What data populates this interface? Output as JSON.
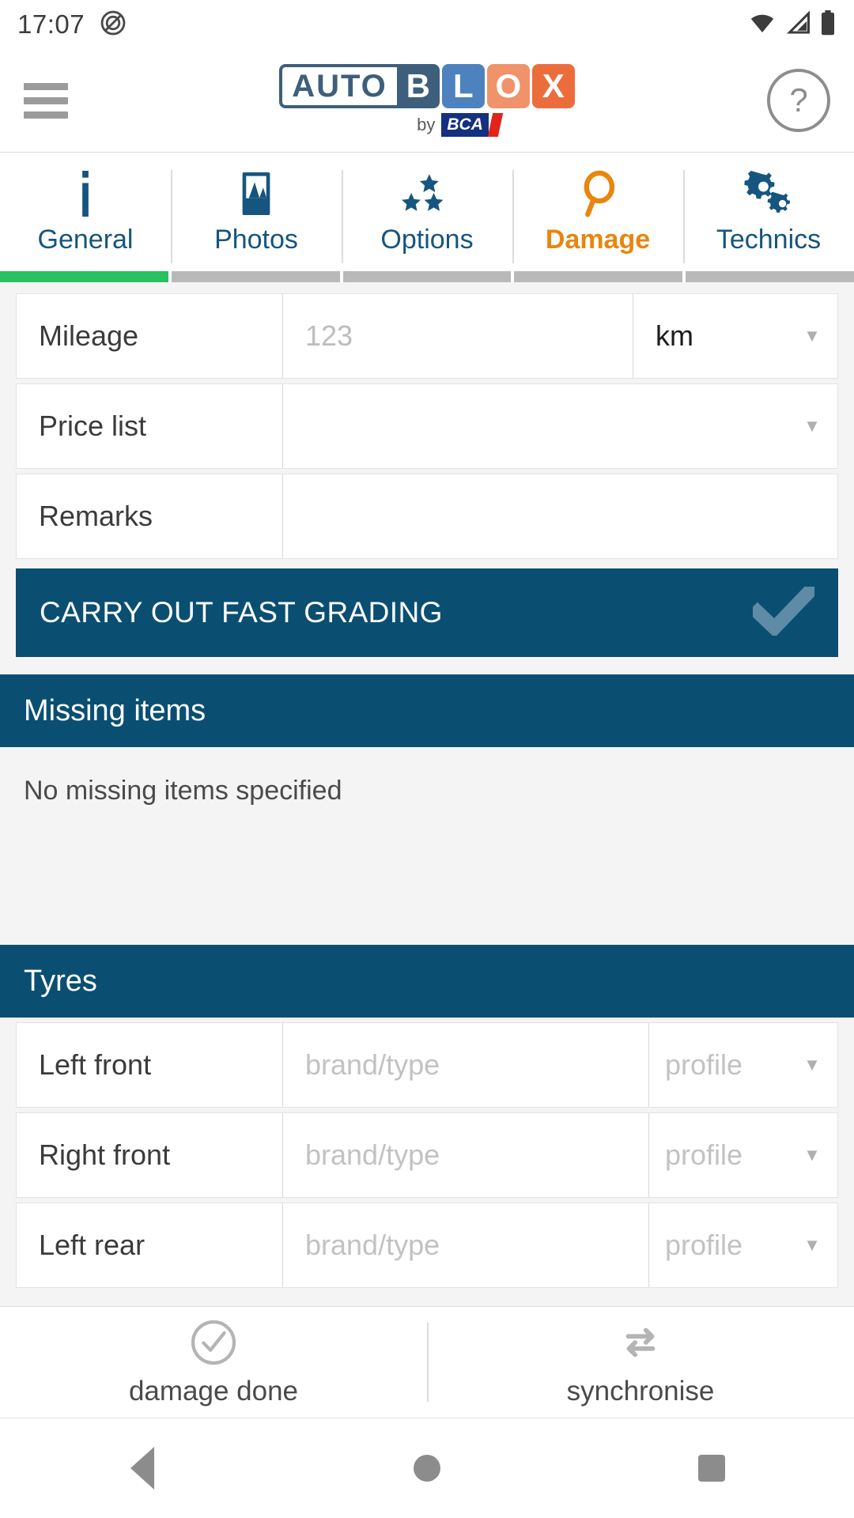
{
  "status_bar": {
    "time": "17:07",
    "icons": [
      "mute-icon",
      "wifi-icon",
      "cellular-signal-icon",
      "battery-icon"
    ]
  },
  "header": {
    "menu_icon": "hamburger-menu-icon",
    "logo": {
      "part_auto": "AUTO",
      "part_b": "B",
      "part_l": "L",
      "part_o": "O",
      "part_x": "X",
      "by_text": "by",
      "bca_text": "BCA",
      "colors": {
        "auto_border": "#3d5f7c",
        "b": "#3d5f7c",
        "l": "#4d82be",
        "o": "#f0936a",
        "x": "#ec6d3c",
        "bca_blue": "#14307e",
        "bca_red": "#e2231a"
      }
    },
    "help_label": "?"
  },
  "tabs": {
    "active_color": "#e8860f",
    "inactive_color": "#16557f",
    "items": [
      {
        "label": "General",
        "icon": "info-icon",
        "active": false,
        "progress": "done"
      },
      {
        "label": "Photos",
        "icon": "image-icon",
        "active": false,
        "progress": "todo"
      },
      {
        "label": "Options",
        "icon": "stars-icon",
        "active": false,
        "progress": "todo"
      },
      {
        "label": "Damage",
        "icon": "magnifier-icon",
        "active": true,
        "progress": "todo"
      },
      {
        "label": "Technics",
        "icon": "gears-icon",
        "active": false,
        "progress": "todo"
      }
    ],
    "progress_done_color": "#27c160",
    "progress_todo_color": "#b9b9b9"
  },
  "form": {
    "fields": [
      {
        "label": "Mileage",
        "value": "",
        "placeholder": "123",
        "unit": "km",
        "has_caret": true
      },
      {
        "label": "Price list",
        "value": "",
        "placeholder": "",
        "unit": "",
        "has_caret": true
      },
      {
        "label": "Remarks",
        "value": "",
        "placeholder": "",
        "unit": "",
        "has_caret": false
      }
    ]
  },
  "fast_grading": {
    "label": "CARRY OUT FAST GRADING",
    "icon": "checkmark-icon",
    "background": "#0a4f71",
    "check_color": "#5e8ba6"
  },
  "missing_items": {
    "title": "Missing items",
    "empty_text": "No missing items specified"
  },
  "tyres": {
    "title": "Tyres",
    "rows": [
      {
        "label": "Left front",
        "brand_placeholder": "brand/type",
        "profile_placeholder": "profile"
      },
      {
        "label": "Right front",
        "brand_placeholder": "brand/type",
        "profile_placeholder": "profile"
      },
      {
        "label": "Left rear",
        "brand_placeholder": "brand/type",
        "profile_placeholder": "profile"
      }
    ]
  },
  "action_bar": {
    "actions": [
      {
        "label": "damage done",
        "icon": "check-circle-icon"
      },
      {
        "label": "synchronise",
        "icon": "sync-arrows-icon"
      }
    ]
  },
  "android_nav": {
    "back": "back-triangle-icon",
    "home": "home-circle-icon",
    "recents": "recents-square-icon"
  }
}
